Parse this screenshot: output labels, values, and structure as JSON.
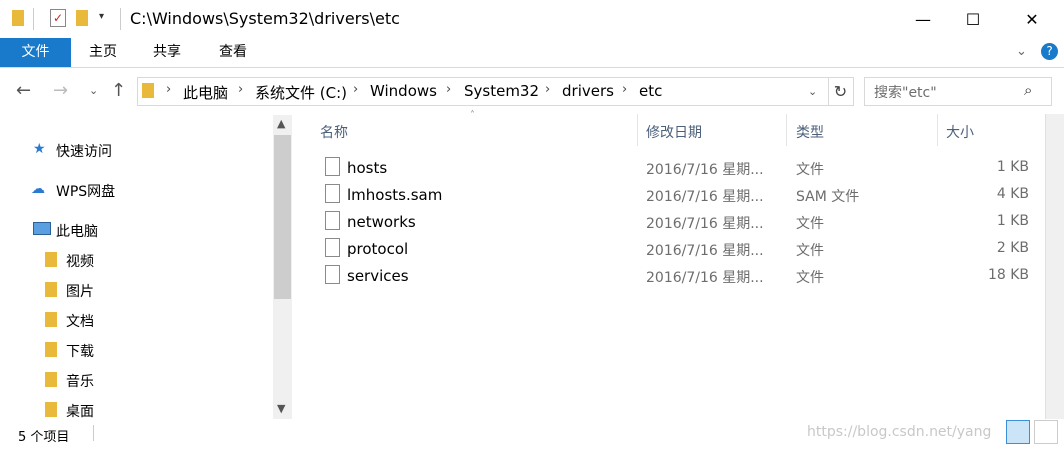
{
  "window": {
    "title": "C:\\Windows\\System32\\drivers\\etc",
    "minimize": "—",
    "maximize": "☐",
    "close": "✕"
  },
  "ribbon": {
    "tabs": [
      "文件",
      "主页",
      "共享",
      "查看"
    ]
  },
  "address": {
    "crumbs": [
      "此电脑",
      "系统文件 (C:)",
      "Windows",
      "System32",
      "drivers",
      "etc"
    ]
  },
  "search": {
    "placeholder": "搜索\"etc\""
  },
  "nav": {
    "quick_access": "快速访问",
    "wps": "WPS网盘",
    "this_pc": "此电脑",
    "items": [
      "视频",
      "图片",
      "文档",
      "下载",
      "音乐",
      "桌面"
    ]
  },
  "columns": [
    "名称",
    "修改日期",
    "类型",
    "大小"
  ],
  "files": [
    {
      "name": "hosts",
      "date": "2016/7/16 星期...",
      "type": "文件",
      "size": "1 KB"
    },
    {
      "name": "lmhosts.sam",
      "date": "2016/7/16 星期...",
      "type": "SAM 文件",
      "size": "4 KB"
    },
    {
      "name": "networks",
      "date": "2016/7/16 星期...",
      "type": "文件",
      "size": "1 KB"
    },
    {
      "name": "protocol",
      "date": "2016/7/16 星期...",
      "type": "文件",
      "size": "2 KB"
    },
    {
      "name": "services",
      "date": "2016/7/16 星期...",
      "type": "文件",
      "size": "18 KB"
    }
  ],
  "status": "5 个项目",
  "watermark": "https://blog.csdn.net/yang"
}
